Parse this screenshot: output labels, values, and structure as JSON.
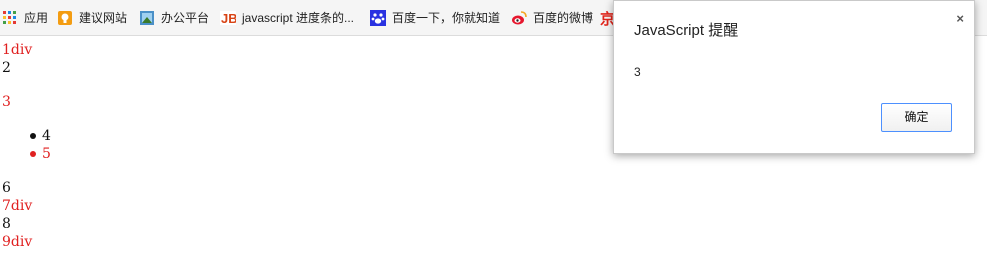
{
  "bookmarks": {
    "items": [
      {
        "label": "应用",
        "icon": "apps-grid-icon"
      },
      {
        "label": "建议网站",
        "icon": "suggested-sites-icon"
      },
      {
        "label": "办公平台",
        "icon": "office-platform-icon"
      },
      {
        "label": "javascript 进度条的...",
        "icon": "js-bookmark-icon"
      },
      {
        "label": "百度一下，你就知道",
        "icon": "baidu-paw-icon"
      },
      {
        "label": "百度的微博",
        "icon": "weibo-icon"
      },
      {
        "label": "",
        "icon": "jd-icon"
      }
    ]
  },
  "page": {
    "lines": [
      {
        "text": "1div",
        "color": "red"
      },
      {
        "text": "2",
        "color": "black"
      },
      {
        "text": "3",
        "color": "red"
      },
      {
        "text": "4",
        "color": "black"
      },
      {
        "text": "5",
        "color": "red"
      },
      {
        "text": "6",
        "color": "black"
      },
      {
        "text": "7div",
        "color": "red"
      },
      {
        "text": "8",
        "color": "black"
      },
      {
        "text": "9div",
        "color": "red"
      }
    ]
  },
  "dialog": {
    "title": "JavaScript 提醒",
    "close_label": "×",
    "message": "3",
    "ok_label": "确定"
  },
  "colors": {
    "red": "#e02020",
    "black": "#111111",
    "button_border": "#4d90fe"
  }
}
